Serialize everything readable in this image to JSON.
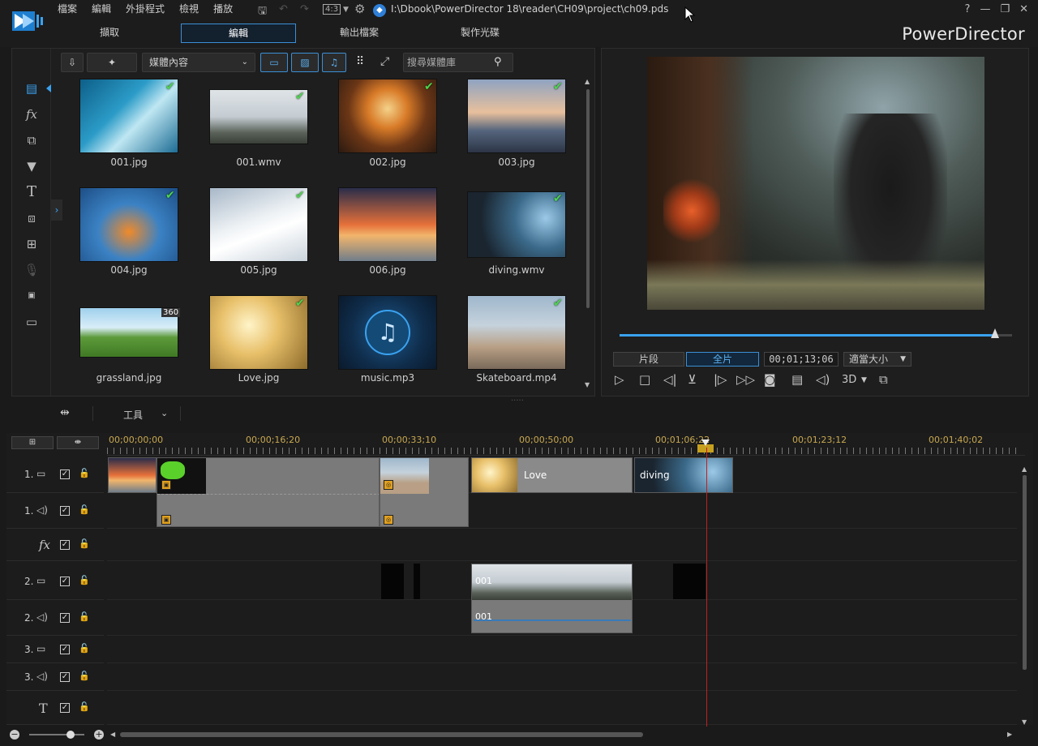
{
  "menu": [
    "檔案",
    "編輯",
    "外掛程式",
    "檢視",
    "播放"
  ],
  "aspect": "4:3",
  "project_path": "I:\\Dbook\\PowerDirector 18\\reader\\CH09\\project\\ch09.pds",
  "window": {
    "help": "?",
    "minimize": "—",
    "restore": "❐",
    "close": "✕"
  },
  "tabs": [
    "擷取",
    "編輯",
    "輸出檔案",
    "製作光碟"
  ],
  "brand": "PowerDirector",
  "library": {
    "dropdown": "媒體內容",
    "search_placeholder": "搜尋媒體庫",
    "items": [
      {
        "name": "001.jpg",
        "checked": true
      },
      {
        "name": "001.wmv",
        "checked": true
      },
      {
        "name": "002.jpg",
        "checked": true
      },
      {
        "name": "003.jpg",
        "checked": true
      },
      {
        "name": "004.jpg",
        "checked": true
      },
      {
        "name": "005.jpg",
        "checked": true
      },
      {
        "name": "006.jpg",
        "checked": false
      },
      {
        "name": "diving.wmv",
        "checked": true
      },
      {
        "name": "grassland.jpg",
        "checked": false,
        "badge": "360"
      },
      {
        "name": "Love.jpg",
        "checked": true
      },
      {
        "name": "music.mp3",
        "checked": false
      },
      {
        "name": "Skateboard.mp4",
        "checked": true
      }
    ]
  },
  "preview": {
    "mode_clip": "片段",
    "mode_movie": "全片",
    "timecode": "00;01;13;06",
    "fit": "適當大小",
    "threed": "3D",
    "progress": 0.96
  },
  "timeline_toolbar": {
    "tools": "工具"
  },
  "ruler": [
    "00;00;00;00",
    "00;00;16;20",
    "00;00;33;10",
    "00;00;50;00",
    "00;01;06;22",
    "00;01;23;12",
    "00;01;40;02"
  ],
  "tracks": [
    {
      "num": "1.",
      "type": "video"
    },
    {
      "num": "1.",
      "type": "audio"
    },
    {
      "num": "",
      "type": "fx",
      "label": "fx"
    },
    {
      "num": "2.",
      "type": "video"
    },
    {
      "num": "2.",
      "type": "audio"
    },
    {
      "num": "3.",
      "type": "video"
    },
    {
      "num": "3.",
      "type": "audio"
    },
    {
      "num": "",
      "type": "title",
      "label": "T"
    }
  ],
  "clip_labels": {
    "love": "Love",
    "diving": "diving",
    "v001": "001",
    "a001": "001"
  }
}
